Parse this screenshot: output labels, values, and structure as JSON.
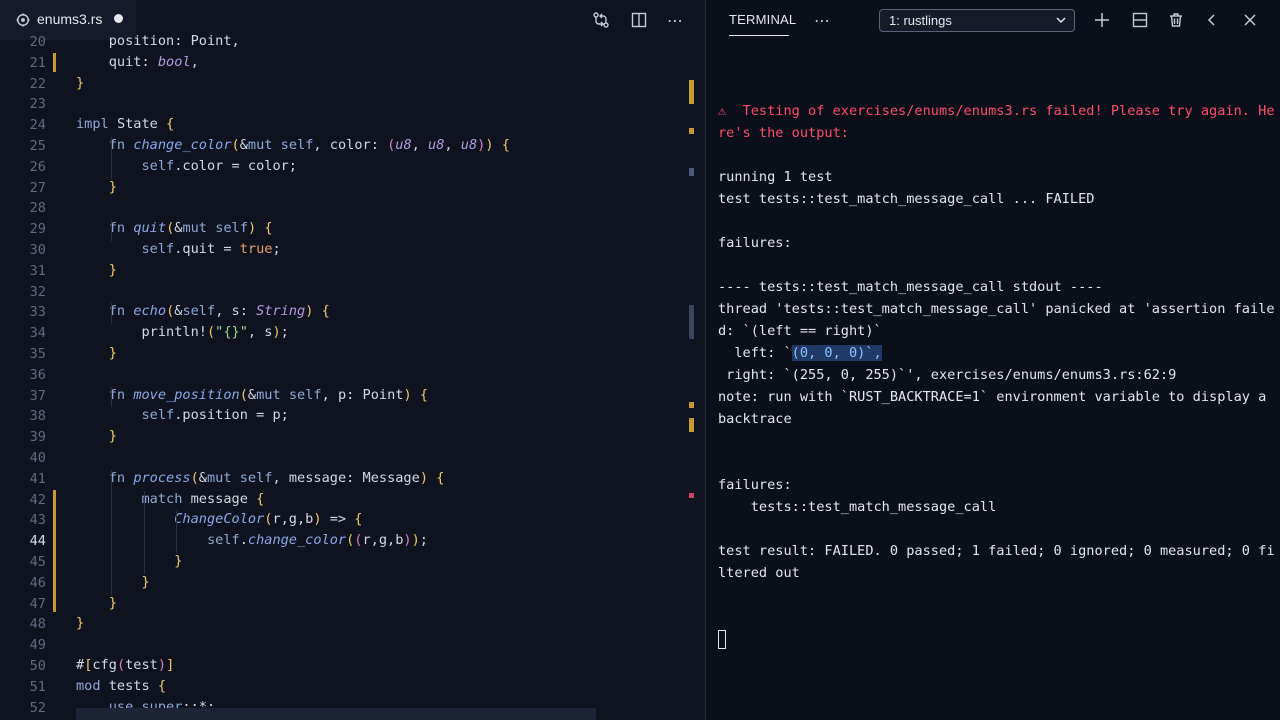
{
  "editor": {
    "tab": {
      "filename": "enums3.rs",
      "dirty": true
    },
    "actions": [
      {
        "name": "open-changes-button",
        "icon": "git-compare-icon"
      },
      {
        "name": "split-editor-button",
        "icon": "split-editor-icon"
      },
      {
        "name": "more-actions-button",
        "icon": "ellipsis-icon",
        "glyph": "⋯"
      }
    ],
    "active_line": 44,
    "lines": [
      {
        "n": "20",
        "text": "    position: Point,"
      },
      {
        "n": "21",
        "text": "    quit: bool,"
      },
      {
        "n": "22",
        "text": "}"
      },
      {
        "n": "23",
        "text": ""
      },
      {
        "n": "24",
        "text": "impl State {"
      },
      {
        "n": "25",
        "text": "    fn change_color(&mut self, color: (u8, u8, u8)) {"
      },
      {
        "n": "26",
        "text": "        self.color = color;"
      },
      {
        "n": "27",
        "text": "    }"
      },
      {
        "n": "28",
        "text": ""
      },
      {
        "n": "29",
        "text": "    fn quit(&mut self) {"
      },
      {
        "n": "30",
        "text": "        self.quit = true;"
      },
      {
        "n": "31",
        "text": "    }"
      },
      {
        "n": "32",
        "text": ""
      },
      {
        "n": "33",
        "text": "    fn echo(&self, s: String) {"
      },
      {
        "n": "34",
        "text": "        println!(\"{}\", s);"
      },
      {
        "n": "35",
        "text": "    }"
      },
      {
        "n": "36",
        "text": ""
      },
      {
        "n": "37",
        "text": "    fn move_position(&mut self, p: Point) {"
      },
      {
        "n": "38",
        "text": "        self.position = p;"
      },
      {
        "n": "39",
        "text": "    }"
      },
      {
        "n": "40",
        "text": ""
      },
      {
        "n": "41",
        "text": "    fn process(&mut self, message: Message) {"
      },
      {
        "n": "42",
        "text": "        match message {"
      },
      {
        "n": "43",
        "text": "            ChangeColor(r,g,b) => {"
      },
      {
        "n": "44",
        "text": "                self.change_color((r,g,b));"
      },
      {
        "n": "45",
        "text": "            }"
      },
      {
        "n": "46",
        "text": "        }"
      },
      {
        "n": "47",
        "text": "    }"
      },
      {
        "n": "48",
        "text": "}"
      },
      {
        "n": "49",
        "text": ""
      },
      {
        "n": "50",
        "text": "#[cfg(test)]"
      },
      {
        "n": "51",
        "text": "mod tests {"
      },
      {
        "n": "52",
        "text": "    use super::*;"
      }
    ]
  },
  "terminal": {
    "tab_label": "TERMINAL",
    "more_glyph": "⋯",
    "selected_shell": "1: rustlings",
    "buttons": [
      {
        "name": "new-terminal-button",
        "icon": "plus-icon"
      },
      {
        "name": "split-terminal-button",
        "icon": "split-terminal-icon"
      },
      {
        "name": "kill-terminal-button",
        "icon": "trash-icon"
      },
      {
        "name": "collapse-panel-button",
        "icon": "chevron-left-icon"
      },
      {
        "name": "close-panel-button",
        "icon": "close-icon"
      }
    ],
    "lines": [
      {
        "text": "⚠  Testing of exercises/enums/enums3.rs failed! Please try again. He",
        "style": "error"
      },
      {
        "text": "re's the output:",
        "style": "error"
      },
      {
        "text": ""
      },
      {
        "text": "running 1 test"
      },
      {
        "text": "test tests::test_match_message_call ... FAILED"
      },
      {
        "text": ""
      },
      {
        "text": "failures:"
      },
      {
        "text": ""
      },
      {
        "text": "---- tests::test_match_message_call stdout ----"
      },
      {
        "text": "thread 'tests::test_match_message_call' panicked at 'assertion faile"
      },
      {
        "text": "d: `(left == right)`"
      },
      {
        "text": "  left: `(0, 0, 0)`,",
        "highlight": "(0, 0, 0)`,"
      },
      {
        "text": " right: `(255, 0, 255)`', exercises/enums/enums3.rs:62:9"
      },
      {
        "text": "note: run with `RUST_BACKTRACE=1` environment variable to display a"
      },
      {
        "text": "backtrace"
      },
      {
        "text": ""
      },
      {
        "text": ""
      },
      {
        "text": "failures:"
      },
      {
        "text": "    tests::test_match_message_call"
      },
      {
        "text": ""
      },
      {
        "text": "test result: FAILED. 0 passed; 1 failed; 0 ignored; 0 measured; 0 fi"
      },
      {
        "text": "ltered out"
      }
    ]
  },
  "colors": {
    "editor_bg": "#0f1320",
    "terminal_bg": "#0b0f1a",
    "error": "#ff4d6a",
    "modified_marker": "#c99a2e",
    "selection": "#1f3a66"
  }
}
